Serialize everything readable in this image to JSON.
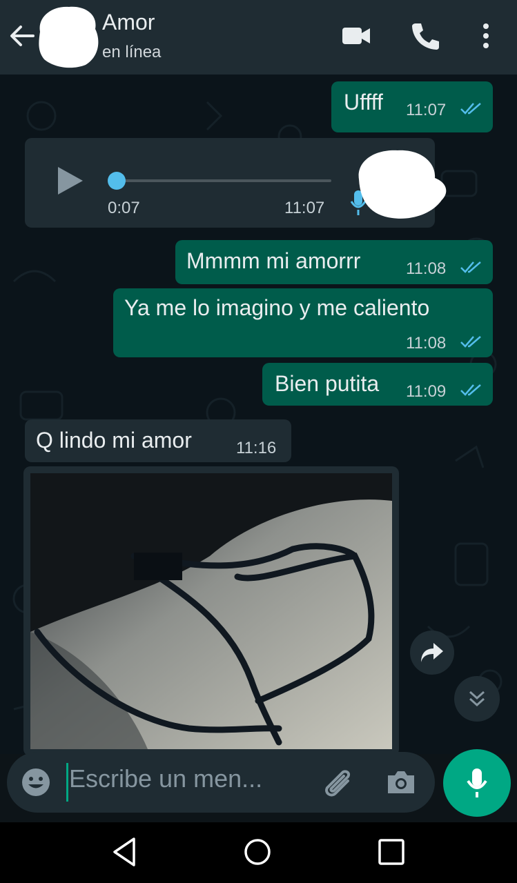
{
  "header": {
    "contact_name": "Amor",
    "status": "en línea"
  },
  "messages": [
    {
      "direction": "outgoing",
      "text": "Uffff",
      "time": "11:07",
      "read": true
    },
    {
      "direction": "incoming",
      "type": "voice-note",
      "duration": "0:07",
      "time": "11:07",
      "progress": 0.0
    },
    {
      "direction": "outgoing",
      "text": "Mmmm mi amorrr",
      "time": "11:08",
      "read": true
    },
    {
      "direction": "outgoing",
      "text": "Ya me lo imagino y me caliento",
      "time": "11:08",
      "read": true
    },
    {
      "direction": "outgoing",
      "text": "Bien putita",
      "time": "11:09",
      "read": true
    },
    {
      "direction": "incoming",
      "text": "Q lindo mi amor",
      "time": "11:16"
    },
    {
      "direction": "incoming",
      "type": "image"
    }
  ],
  "composer": {
    "placeholder": "Escribe un men..."
  },
  "colors": {
    "header": "#1f2c33",
    "chat_bg": "#0b141a",
    "outgoing_bubble": "#005c4b",
    "incoming_bubble": "#1f2c33",
    "accent": "#00a884",
    "read_ticks": "#53bdeb"
  },
  "icons": {
    "back": "arrow-left-icon",
    "video": "video-call-icon",
    "call": "phone-icon",
    "menu": "more-vert-icon",
    "play": "play-icon",
    "mic_small": "microphone-icon",
    "forward": "forward-icon",
    "scroll_down": "double-chevron-down-icon",
    "emoji": "emoji-icon",
    "attach": "paperclip-icon",
    "camera": "camera-icon",
    "send_voice": "microphone-icon",
    "nav_back": "triangle-back-icon",
    "nav_home": "circle-home-icon",
    "nav_recents": "square-recents-icon"
  }
}
